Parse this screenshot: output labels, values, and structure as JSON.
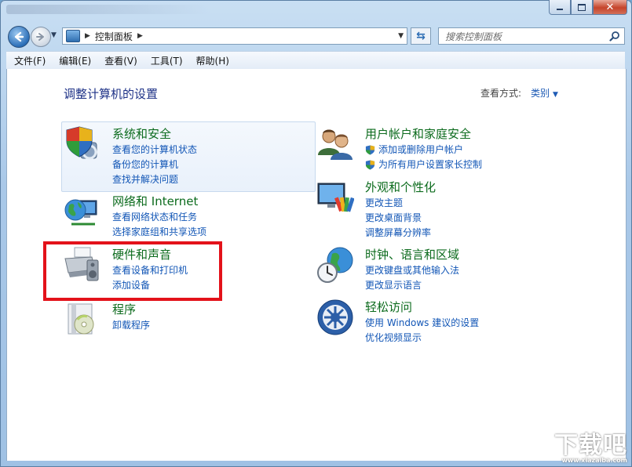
{
  "window": {
    "caption_buttons": {
      "minimize_icon": "minimize-icon",
      "maximize_icon": "maximize-icon",
      "close_icon": "close-icon"
    }
  },
  "nav": {
    "breadcrumb": [
      "控制面板"
    ],
    "search_placeholder": "搜索控制面板"
  },
  "menu": [
    "文件(F)",
    "编辑(E)",
    "查看(V)",
    "工具(T)",
    "帮助(H)"
  ],
  "content": {
    "title": "调整计算机的设置",
    "view_by_label": "查看方式:",
    "view_by_value": "类别"
  },
  "categories": [
    {
      "title": "系统和安全",
      "icon": "shield-computer-icon",
      "links": [
        {
          "text": "查看您的计算机状态"
        },
        {
          "text": "备份您的计算机"
        },
        {
          "text": "查找并解决问题"
        }
      ]
    },
    {
      "title": "网络和 Internet",
      "icon": "network-globe-icon",
      "links": [
        {
          "text": "查看网络状态和任务"
        },
        {
          "text": "选择家庭组和共享选项"
        }
      ]
    },
    {
      "title": "硬件和声音",
      "icon": "printer-speaker-icon",
      "links": [
        {
          "text": "查看设备和打印机"
        },
        {
          "text": "添加设备"
        }
      ]
    },
    {
      "title": "程序",
      "icon": "programs-disc-icon",
      "links": [
        {
          "text": "卸载程序"
        }
      ]
    },
    {
      "title": "用户帐户和家庭安全",
      "icon": "users-icon",
      "links": [
        {
          "text": "添加或删除用户帐户",
          "shield": true
        },
        {
          "text": "为所有用户设置家长控制",
          "shield": true
        }
      ]
    },
    {
      "title": "外观和个性化",
      "icon": "monitor-palette-icon",
      "links": [
        {
          "text": "更改主题"
        },
        {
          "text": "更改桌面背景"
        },
        {
          "text": "调整屏幕分辨率"
        }
      ]
    },
    {
      "title": "时钟、语言和区域",
      "icon": "clock-globe-icon",
      "links": [
        {
          "text": "更改键盘或其他输入法"
        },
        {
          "text": "更改显示语言"
        }
      ]
    },
    {
      "title": "轻松访问",
      "icon": "ease-of-access-icon",
      "links": [
        {
          "text": "使用 Windows 建议的设置"
        },
        {
          "text": "优化视频显示"
        }
      ]
    }
  ],
  "watermark": {
    "text": "下载吧",
    "sub": "www.xiazaiba.com"
  }
}
